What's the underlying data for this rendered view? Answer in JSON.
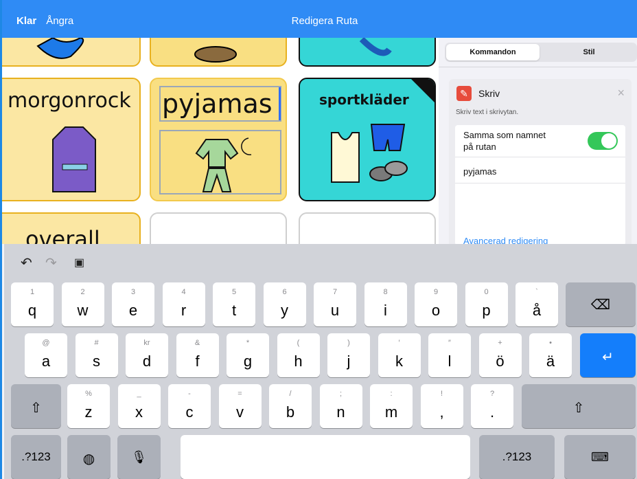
{
  "topbar": {
    "done": "Klar",
    "undo": "Ångra",
    "title": "Redigera Ruta"
  },
  "tiles": {
    "morning_robe": "morgonrock",
    "pajamas": "pyjamas",
    "sportswear": "sportkläder",
    "overall": "overall"
  },
  "segment": {
    "commands": "Kommandon",
    "style": "Stil"
  },
  "command": {
    "title": "Skriv",
    "description": "Skriv text i skrivytan.",
    "same_as_name": "Samma som namnet",
    "same_as_name_2": "på rutan",
    "toggle_on": true,
    "text_value": "pyjamas",
    "advanced": "Avancerad redigering"
  },
  "keyboard": {
    "row1": [
      {
        "sub": "1",
        "main": "q"
      },
      {
        "sub": "2",
        "main": "w"
      },
      {
        "sub": "3",
        "main": "e"
      },
      {
        "sub": "4",
        "main": "r"
      },
      {
        "sub": "5",
        "main": "t"
      },
      {
        "sub": "6",
        "main": "y"
      },
      {
        "sub": "7",
        "main": "u"
      },
      {
        "sub": "8",
        "main": "i"
      },
      {
        "sub": "9",
        "main": "o"
      },
      {
        "sub": "0",
        "main": "p"
      },
      {
        "sub": "`",
        "main": "å"
      }
    ],
    "row2": [
      {
        "sub": "@",
        "main": "a"
      },
      {
        "sub": "#",
        "main": "s"
      },
      {
        "sub": "kr",
        "main": "d"
      },
      {
        "sub": "&",
        "main": "f"
      },
      {
        "sub": "*",
        "main": "g"
      },
      {
        "sub": "(",
        "main": "h"
      },
      {
        "sub": ")",
        "main": "j"
      },
      {
        "sub": "′",
        "main": "k"
      },
      {
        "sub": "″",
        "main": "l"
      },
      {
        "sub": "+",
        "main": "ö"
      },
      {
        "sub": "•",
        "main": "ä"
      }
    ],
    "row3": [
      {
        "sub": "%",
        "main": "z"
      },
      {
        "sub": "_",
        "main": "x"
      },
      {
        "sub": "-",
        "main": "c"
      },
      {
        "sub": "=",
        "main": "v"
      },
      {
        "sub": "/",
        "main": "b"
      },
      {
        "sub": ";",
        "main": "n"
      },
      {
        "sub": ":",
        "main": "m"
      },
      {
        "sub": "!",
        "main": ","
      },
      {
        "sub": "?",
        "main": "."
      }
    ],
    "numbers": ".?123"
  }
}
